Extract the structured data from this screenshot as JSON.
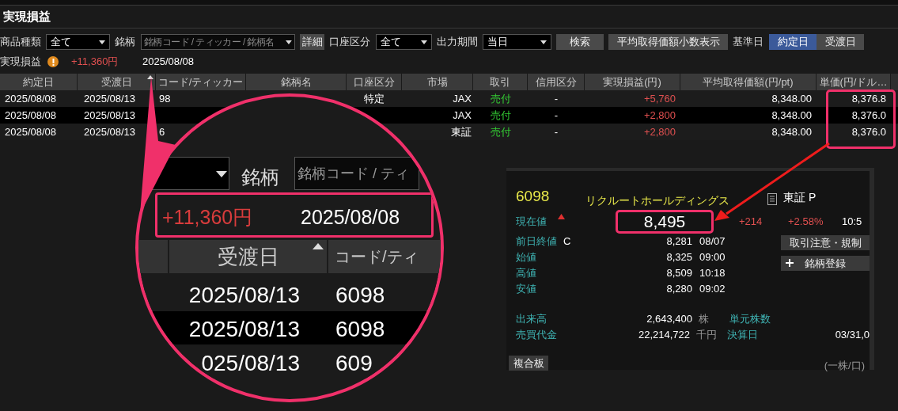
{
  "title": "実現損益",
  "filters": [
    {
      "kind": "label",
      "text": "商品種類"
    },
    {
      "kind": "select",
      "value": "全て"
    },
    {
      "kind": "label",
      "text": "銘柄"
    },
    {
      "kind": "field",
      "placeholder": "銘柄コード / ティッカー / 銘柄名"
    },
    {
      "kind": "button",
      "text": "詳細"
    },
    {
      "kind": "label",
      "text": "口座区分"
    },
    {
      "kind": "select",
      "value": "全て"
    },
    {
      "kind": "label",
      "text": "出力期間"
    },
    {
      "kind": "select",
      "value": "当日"
    },
    {
      "kind": "button",
      "text": "検索"
    },
    {
      "kind": "button",
      "text": "平均取得価額小数表示"
    },
    {
      "kind": "label",
      "text": "基準日"
    },
    {
      "kind": "toggle",
      "options": [
        {
          "label": "約定日",
          "selected": true
        },
        {
          "label": "受渡日",
          "selected": false
        }
      ]
    }
  ],
  "summary": {
    "label": "実現損益",
    "total": "+11,360円",
    "date": "2025/08/08"
  },
  "table": {
    "columns": [
      {
        "label": "約定日",
        "sorted": false
      },
      {
        "label": "受渡日",
        "sorted": true
      },
      {
        "label": "コード/ティッカー",
        "sorted": false
      },
      {
        "label": "銘柄名",
        "sorted": false
      },
      {
        "label": "口座区分",
        "sorted": false
      },
      {
        "label": "市場",
        "sorted": false
      },
      {
        "label": "取引",
        "sorted": false
      },
      {
        "label": "信用区分",
        "sorted": false
      },
      {
        "label": "実現損益(円)",
        "sorted": false
      },
      {
        "label": "平均取得価額(円/pt)",
        "sorted": false
      },
      {
        "label": "単価(円/ドル…",
        "sorted": false
      }
    ],
    "rows": [
      {
        "cells": [
          "2025/08/08",
          "2025/08/13",
          "98",
          null,
          "特定",
          "JAX",
          "売付",
          "-",
          "+5,760",
          "8,348.00",
          "8,376.8"
        ]
      },
      {
        "cells": [
          "2025/08/08",
          "2025/08/13",
          null,
          null,
          null,
          "JAX",
          "売付",
          "-",
          "+2,800",
          "8,348.00",
          "8,376.0"
        ]
      },
      {
        "cells": [
          "2025/08/08",
          "2025/08/13",
          "6",
          null,
          null,
          "東証",
          "売付",
          "-",
          "+2,800",
          "8,348.00",
          "8,376.0"
        ]
      }
    ]
  },
  "magnifier": {
    "label": "銘柄",
    "placeholder": "銘柄コード / ティ",
    "total": "+11,360円",
    "date": "2025/08/08",
    "columns": [
      {
        "label": "受渡日",
        "sorted": true
      },
      {
        "label": "コード/ティ",
        "sorted": false
      }
    ],
    "rows": [
      {
        "settlement": "2025/08/13",
        "code": "6098"
      },
      {
        "settlement": "2025/08/13",
        "code": "6098"
      },
      {
        "settlement": "025/08/13",
        "code": "609"
      }
    ]
  },
  "quote": {
    "code": "6098",
    "name": "リクルートホールディングス",
    "market": "東証 P",
    "current_label": "現在値",
    "price": "8,495",
    "change": "+214",
    "change_pct": "+2.58%",
    "time": "10:5",
    "stats": [
      {
        "label": "前日終値",
        "flag": "C",
        "value": "8,281",
        "time": "08/07"
      },
      {
        "label": "始値",
        "value": "8,325",
        "time": "09:00"
      },
      {
        "label": "高値",
        "value": "8,509",
        "time": "10:18"
      },
      {
        "label": "安値",
        "value": "8,280",
        "time": "09:02"
      }
    ],
    "buttons": [
      {
        "kind": "text",
        "label": "取引注意・規制"
      },
      {
        "kind": "add",
        "label": "銘柄登録"
      }
    ],
    "volume": [
      {
        "label": "出来高",
        "value": "2,643,400",
        "unit": "株",
        "label_2": "単元株数"
      },
      {
        "label": "売買代金",
        "value": "22,214,722",
        "unit": "千円",
        "label_2": "決算日",
        "value_2": "03/31,0"
      }
    ],
    "board_button": "複合板",
    "unit_note": "(一株/口)"
  }
}
